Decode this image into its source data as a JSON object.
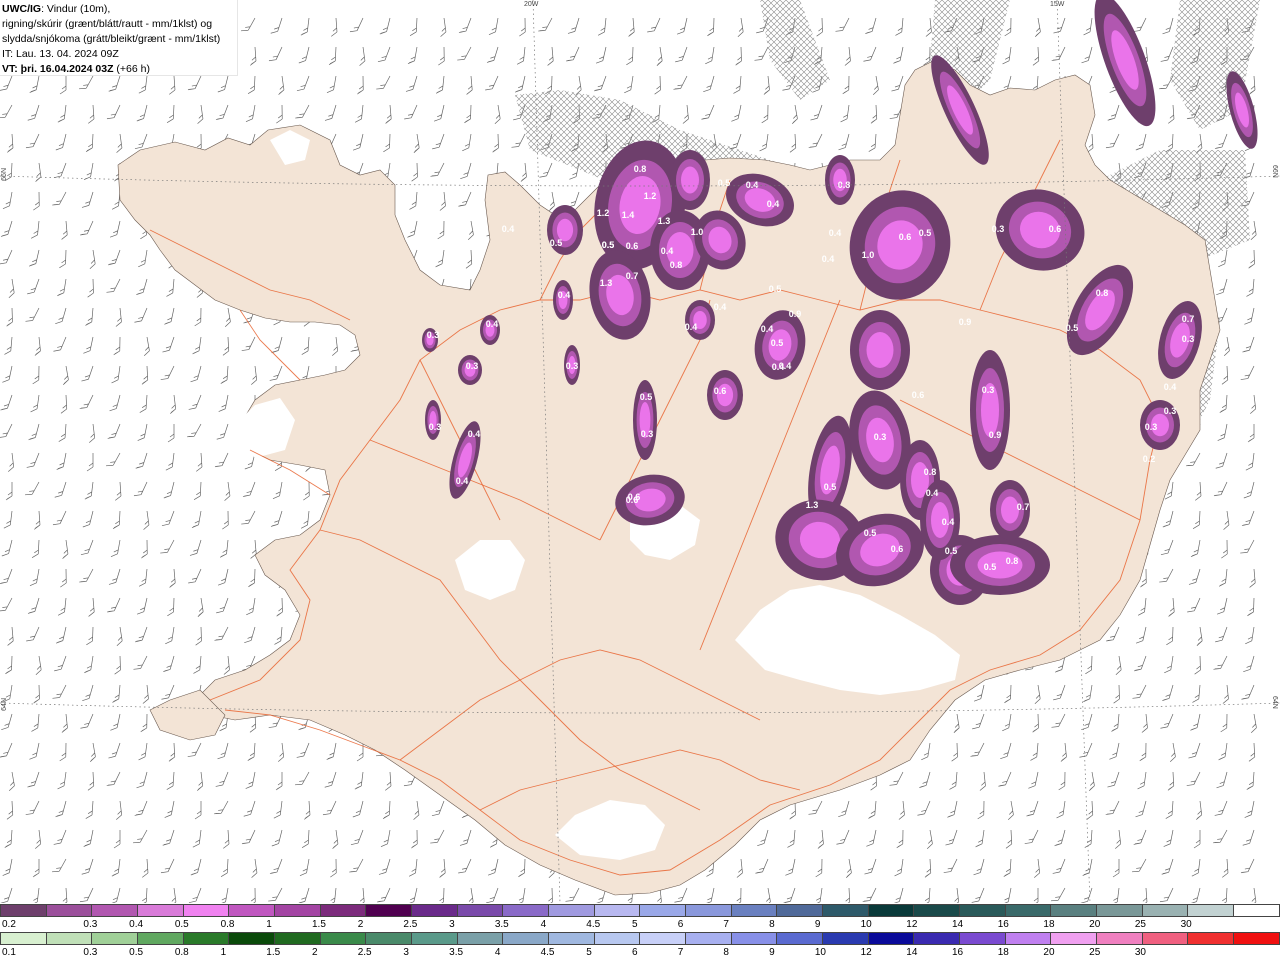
{
  "info": {
    "product": "UWC/IG",
    "desc_line1": ": Vindur (10m),",
    "desc_line2": "rigning/skúrir (grænt/blátt/rautt - mm/1klst) og",
    "desc_line3": "slydda/snjókoma (grátt/bleikt/grænt - mm/1klst)",
    "it_line": "IT: Lau. 13. 04. 2024 09Z",
    "vt_bold": "VT: þri. 16.04.2024 03Z",
    "vt_rest": " (+66 h)"
  },
  "coords": {
    "lon_20w": "20W",
    "lon_15w": "15W",
    "lat_66n_left": "66N",
    "lat_66n_right": "66N",
    "lat_64n_left": "64N",
    "lat_64n_right": "64N"
  },
  "colors": {
    "land": "#f3e4d6",
    "road": "#e8632f",
    "sea": "#ffffff",
    "glacier": "#ffffff",
    "precip_low": "#6e3f6c",
    "precip_mid": "#b157b0",
    "precip_high": "#ea74ea",
    "hatch": "#8a8a8a"
  },
  "precip_labels": [
    {
      "t": "0.8"
    },
    {
      "t": "1.4"
    },
    {
      "t": "1.2"
    },
    {
      "t": "1.2"
    },
    {
      "t": "0.5"
    },
    {
      "t": "0.6"
    },
    {
      "t": "1.3"
    },
    {
      "t": "0.4"
    },
    {
      "t": "1.0"
    },
    {
      "t": "0.8"
    },
    {
      "t": "1.3"
    },
    {
      "t": "0.7"
    },
    {
      "t": "0.5"
    },
    {
      "t": "0.4"
    },
    {
      "t": "0.5"
    },
    {
      "t": "0.4"
    },
    {
      "t": "0.3"
    },
    {
      "t": "0.4"
    },
    {
      "t": "0.3"
    },
    {
      "t": "0.3"
    },
    {
      "t": "0.4"
    },
    {
      "t": "0.3"
    },
    {
      "t": "0.4"
    },
    {
      "t": "0.3"
    },
    {
      "t": "0.6"
    },
    {
      "t": "0.6"
    },
    {
      "t": "0.5"
    },
    {
      "t": "0.5"
    },
    {
      "t": "0.4"
    },
    {
      "t": "0.4"
    },
    {
      "t": "0.4"
    },
    {
      "t": "0.4"
    },
    {
      "t": "0.5"
    },
    {
      "t": "0.4"
    },
    {
      "t": "0.9"
    },
    {
      "t": "0.4"
    },
    {
      "t": "0.5"
    },
    {
      "t": "0.8"
    },
    {
      "t": "1.0"
    },
    {
      "t": "0.6"
    },
    {
      "t": "0.5"
    },
    {
      "t": "0.9"
    },
    {
      "t": "0.3"
    },
    {
      "t": "0.6"
    },
    {
      "t": "0.8"
    },
    {
      "t": "0.5"
    },
    {
      "t": "0.7"
    },
    {
      "t": "0.3"
    },
    {
      "t": "0.4"
    },
    {
      "t": "0.3"
    },
    {
      "t": "0.3"
    },
    {
      "t": "0.2"
    },
    {
      "t": "0.3"
    },
    {
      "t": "0.9"
    },
    {
      "t": "0.6"
    },
    {
      "t": "0.3"
    },
    {
      "t": "0.8"
    },
    {
      "t": "0.4"
    },
    {
      "t": "0.4"
    },
    {
      "t": "0.4"
    },
    {
      "t": "0.6"
    },
    {
      "t": "0.5"
    },
    {
      "t": "0.6"
    },
    {
      "t": "1.3"
    },
    {
      "t": "0.5"
    },
    {
      "t": "0.5"
    },
    {
      "t": "0.8"
    },
    {
      "t": "0.7"
    },
    {
      "t": "0.5"
    },
    {
      "t": "0.4"
    },
    {
      "t": "0.4"
    }
  ],
  "legend": {
    "snow_colors": [
      "#6e3f6c",
      "#9b4f9b",
      "#b157b0",
      "#d97bd9",
      "#f082f0",
      "#c057c0",
      "#a344a3",
      "#7c2b7c",
      "#500050",
      "#6a2a8a",
      "#7a4aaa",
      "#8a6ac8",
      "#a09ae0",
      "#b8b8f0",
      "#9aa8e8",
      "#8a98dc",
      "#6a80c0",
      "#506a9a",
      "#2e5a6a",
      "#0a3a3a",
      "#1a4a4a",
      "#2a5a5a",
      "#3a6a6a",
      "#5a8080",
      "#7a9898",
      "#9ab2b2",
      "#c2d2d2",
      "#ffffff"
    ],
    "snow_labels": [
      "0.2",
      "0.3",
      "0.4",
      "0.5",
      "0.8",
      "1",
      "1.5",
      "2",
      "2.5",
      "3",
      "3.5",
      "4",
      "4.5",
      "5",
      "6",
      "7",
      "8",
      "9",
      "10",
      "12",
      "14",
      "16",
      "18",
      "20",
      "25",
      "30"
    ],
    "rain_colors": [
      "#d8f0d0",
      "#c0e0b8",
      "#a0d098",
      "#60a860",
      "#2a7a2a",
      "#0a4a0a",
      "#206a20",
      "#3a8a4a",
      "#4a8a6a",
      "#5a9a8a",
      "#7aa0a8",
      "#8aa8c8",
      "#a0b8e0",
      "#b8c8f0",
      "#c8d0f8",
      "#a8b0f0",
      "#8890e8",
      "#5a6ad0",
      "#2a3ab0",
      "#0a0a9a",
      "#3a2ab0",
      "#7a4ad0",
      "#c080f0",
      "#f0a0f0",
      "#f080c0",
      "#f06080",
      "#f03030",
      "#f01010"
    ],
    "rain_labels": [
      "0.1",
      "0.3",
      "0.5",
      "0.8",
      "1",
      "1.5",
      "2",
      "2.5",
      "3",
      "3.5",
      "4",
      "4.5",
      "5",
      "6",
      "7",
      "8",
      "9",
      "10",
      "12",
      "14",
      "16",
      "18",
      "20",
      "25",
      "30"
    ]
  }
}
